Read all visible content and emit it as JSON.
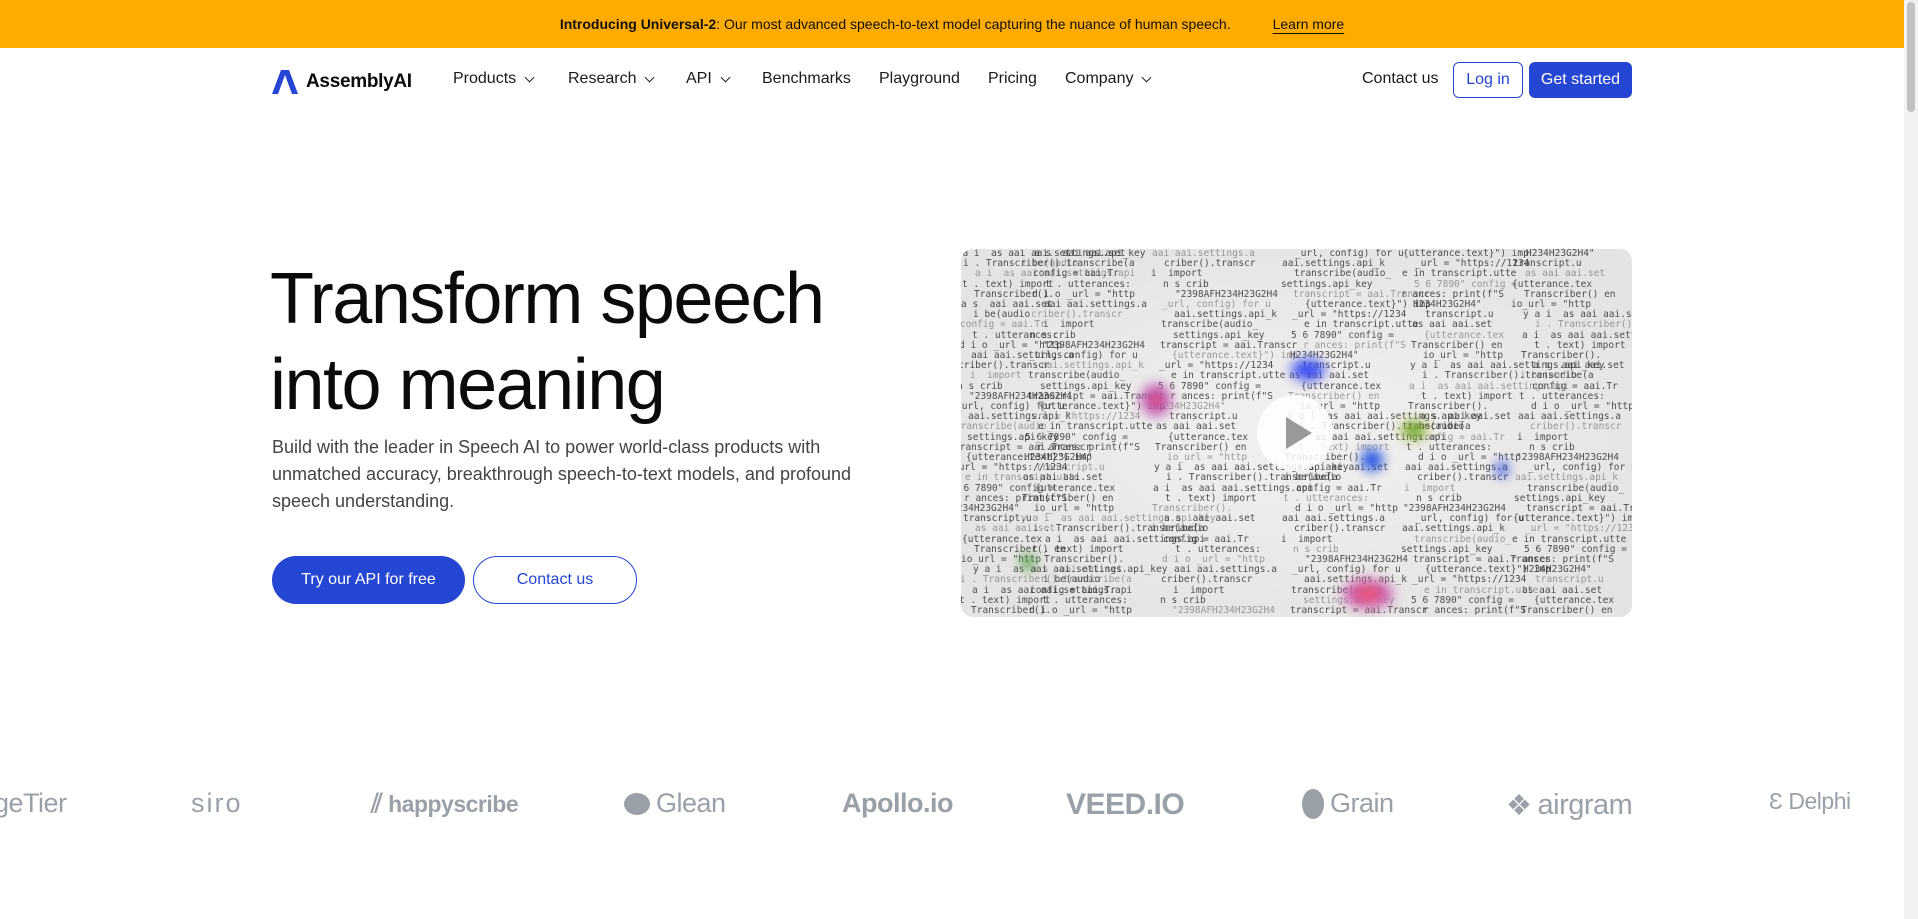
{
  "banner": {
    "bold": "Introducing Universal-2",
    "text": ": Our most advanced speech-to-text model capturing the nuance of human speech.",
    "link": "Learn more"
  },
  "nav": {
    "brand": "AssemblyAI",
    "brand_color": "#2545d3",
    "items": [
      {
        "label": "Products",
        "dropdown": true
      },
      {
        "label": "Research",
        "dropdown": true
      },
      {
        "label": "API",
        "dropdown": true
      },
      {
        "label": "Benchmarks"
      },
      {
        "label": "Playground"
      },
      {
        "label": "Pricing"
      },
      {
        "label": "Company",
        "dropdown": true
      }
    ],
    "contact": "Contact us",
    "login": "Log in",
    "get_started": "Get started"
  },
  "hero": {
    "title_line1": "Transform speech",
    "title_line2": "into meaning",
    "subtitle": "Build with the leader in Speech AI to power world-class products with unmatched accuracy, breakthrough speech-to-text models, and profound speech understanding.",
    "cta_primary": "Try our API for free",
    "cta_secondary": "Contact us"
  },
  "video": {
    "play_icon": "play-icon",
    "code_lines": [
      "y a i  as aai aai.settings.api_key",
      "i . Transcriber().transcribe(a",
      "a i  as aai aai.settings.api",
      "t . text) import",
      "Transcriber().",
      "a s  aai aai.set",
      "i be(audio",
      "config = aai.Tr",
      "t . utterances:",
      "d i o _url = \"http",
      "aai aai.settings.a",
      "criber().transcr",
      "i  import",
      "n s crib",
      "\"2398AFH234H23G2H4",
      "_url, config) for u",
      "aai.settings.api_k",
      "transcribe(audio_",
      "settings.api_key",
      "transcript = aai.Transcr",
      "{utterance.text}\") imp",
      "_url = \"https://1234",
      "e in transcript.utte",
      "5 6 7890\" config =",
      "r ances: print(f\"S",
      "H234H23G2H4\"",
      "transcript.u",
      "as aai aai.set",
      "{utterance.tex",
      "Transcriber() en",
      "io_url = \"http"
    ]
  },
  "logos": [
    "geTier",
    "siro",
    "happyscribe",
    "Glean",
    "Apollo.io",
    "VEED.IO",
    "Grain",
    "airgram",
    "Delphi"
  ]
}
